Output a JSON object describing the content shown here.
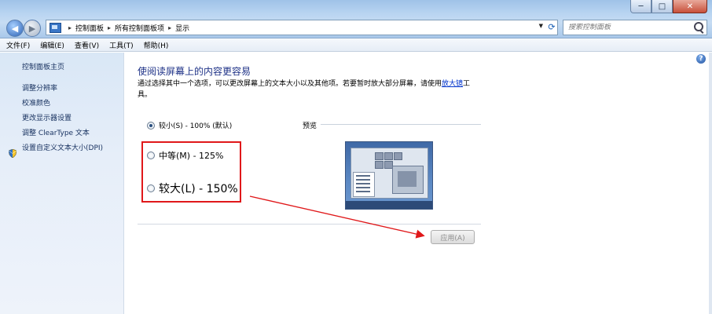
{
  "window": {
    "caption_buttons": {
      "minimize": "─",
      "maximize": "□",
      "close": "✕"
    }
  },
  "addressbar": {
    "crumbs": [
      "控制面板",
      "所有控制面板项",
      "显示"
    ],
    "search_placeholder": "搜索控制面板"
  },
  "menu": [
    "文件(F)",
    "编辑(E)",
    "查看(V)",
    "工具(T)",
    "帮助(H)"
  ],
  "sidebar": {
    "home": "控制面板主页",
    "items": [
      "调整分辨率",
      "校准颜色",
      "更改显示器设置",
      "调整 ClearType 文本",
      "设置自定义文本大小(DPI)"
    ]
  },
  "main": {
    "title": "使阅读屏幕上的内容更容易",
    "description_prefix": "通过选择其中一个选项，可以更改屏幕上的文本大小以及其他项。若要暂时放大部分屏幕，请使用",
    "magnifier_link": "放大镜",
    "description_suffix": "工具。",
    "options": [
      {
        "label": "较小(S) - 100% (默认)",
        "selected": true
      },
      {
        "label": "中等(M) - 125%",
        "selected": false
      },
      {
        "label": "较大(L) - 150%",
        "selected": false
      }
    ],
    "preview_label": "预览",
    "apply_label": "应用(A)",
    "apply_enabled": false
  },
  "colors": {
    "highlight": "#e0181a",
    "title": "#1e3287",
    "link": "#0033cc"
  }
}
